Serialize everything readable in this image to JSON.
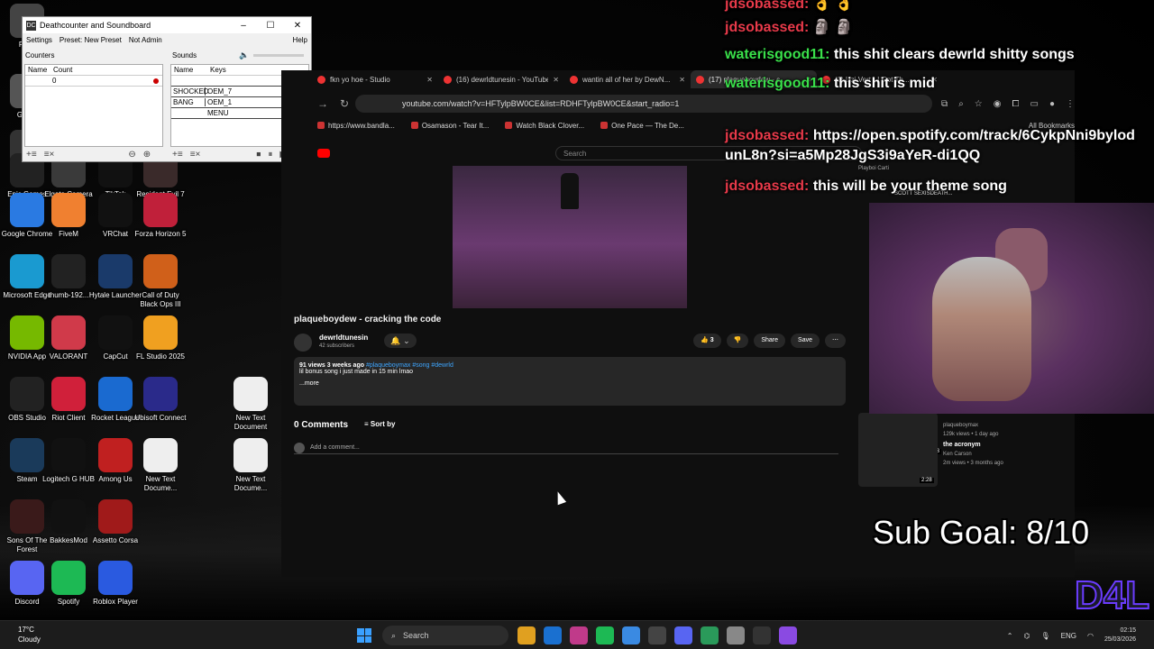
{
  "desktop": {
    "icons": [
      {
        "label": "Recy",
        "color": "#444"
      },
      {
        "label": "Grand",
        "color": "#555"
      },
      {
        "label": "EI",
        "color": "#333"
      },
      {
        "label": "Epic Games Launcher",
        "color": "#222"
      },
      {
        "label": "Elgato Camera Hub",
        "color": "#3a3a3a"
      },
      {
        "label": "TikTok",
        "color": "#111"
      },
      {
        "label": "Resident Evil 7 Biohazard",
        "color": "#3a2a2a"
      },
      {
        "label": "Google Chrome",
        "color": "#2a7ae2"
      },
      {
        "label": "FiveM",
        "color": "#f08030"
      },
      {
        "label": "VRChat",
        "color": "#111"
      },
      {
        "label": "Forza Horizon 5",
        "color": "#c0203a"
      },
      {
        "label": "Microsoft Edge",
        "color": "#1a9ad0"
      },
      {
        "label": "thumb-192...",
        "color": "#222"
      },
      {
        "label": "Hytale Launcher",
        "color": "#1a3a6a"
      },
      {
        "label": "Call of Duty Black Ops III",
        "color": "#d0601a"
      },
      {
        "label": "NVIDIA App",
        "color": "#76b900"
      },
      {
        "label": "VALORANT",
        "color": "#d03a4a"
      },
      {
        "label": "CapCut",
        "color": "#111"
      },
      {
        "label": "FL Studio 2025",
        "color": "#f0a020"
      },
      {
        "label": "OBS Studio",
        "color": "#222"
      },
      {
        "label": "Riot Client",
        "color": "#d0203a"
      },
      {
        "label": "Rocket League",
        "color": "#1a6ad0"
      },
      {
        "label": "Ubisoft Connect",
        "color": "#2a2a8a"
      },
      {
        "label": "New Text Document",
        "color": "#eee"
      },
      {
        "label": "Steam",
        "color": "#1a3a5a"
      },
      {
        "label": "Logitech G HUB",
        "color": "#111"
      },
      {
        "label": "Among Us",
        "color": "#c02020"
      },
      {
        "label": "New Text Docume...",
        "color": "#eee"
      },
      {
        "label": "New Text Docume...",
        "color": "#eee"
      },
      {
        "label": "Sons Of The Forest",
        "color": "#3a1a1a"
      },
      {
        "label": "BakkesMod",
        "color": "#111"
      },
      {
        "label": "Assetto Corsa",
        "color": "#a01a1a"
      },
      {
        "label": "Discord",
        "color": "#5865f2"
      },
      {
        "label": "Spotify",
        "color": "#1db954"
      },
      {
        "label": "Roblox Player",
        "color": "#2a5ae0"
      }
    ]
  },
  "deathcounter": {
    "title": "Deathcounter and Soundboard",
    "menu": {
      "settings": "Settings",
      "preset": "Preset: New Preset",
      "admin": "Not Admin",
      "help": "Help"
    },
    "counters_label": "Counters",
    "counters_cols": [
      "Name",
      "Count"
    ],
    "counter_value": "0",
    "sounds_label": "Sounds",
    "sounds_cols": [
      "Name",
      "Keys"
    ],
    "sounds": [
      {
        "name": "",
        "key": ""
      },
      {
        "name": "SHOCKED",
        "key": "OEM_7"
      },
      {
        "name": "BANG",
        "key": "OEM_1"
      },
      {
        "name": "",
        "key": "MENU"
      }
    ]
  },
  "browser": {
    "tabs": [
      {
        "title": "fkn yo hoe - Studio",
        "active": false
      },
      {
        "title": "(16) dewrldtunesin - YouTube",
        "active": false
      },
      {
        "title": "wantin all of her by DewN...",
        "active": false
      },
      {
        "title": "(17) plaqueboydew - c...",
        "active": true
      },
      {
        "title": "(1) Uzi Vert - I Got Th...",
        "active": false
      }
    ],
    "url": "youtube.com/watch?v=HFTylpBW0CE&list=RDHFTylpBW0CE&start_radio=1",
    "bookmarks": [
      "https://www.bandla...",
      "Osamason - Tear It...",
      "Watch Black Clover...",
      "One Pace — The De..."
    ],
    "all_bookmarks": "All Bookmarks",
    "search_placeholder": "Search"
  },
  "video": {
    "title": "plaqueboydew - cracking the code",
    "channel": "dewrldtunesin",
    "subscribers": "42 subscribers",
    "likes": "3",
    "share": "Share",
    "save": "Save",
    "views": "91 views  3 weeks ago",
    "tags": "#plaqueboymax #song #dewrld",
    "description": "lil bonus song i just made in 15 min lmao",
    "more": "...more",
    "comments": "0 Comments",
    "sort_by": "Sort by",
    "add_comment": "Add a comment..."
  },
  "sidebar": [
    {
      "title": "",
      "channel": "plaqueboymax",
      "meta": "129k views • 1 day ago",
      "duration": "1:14:43"
    },
    {
      "title": "the acronym",
      "channel": "Ken Carson",
      "meta": "2m views • 3 months ago",
      "duration": "2:28"
    }
  ],
  "sidebar_top": {
    "channel": "Playboi Carti",
    "title": "SCOTT SEXISDEATH..."
  },
  "chat": [
    {
      "user": "jdsobassed:",
      "user_color": "#e83a4a",
      "msg": "",
      "emoji": "👌 👌"
    },
    {
      "user": "jdsobassed:",
      "user_color": "#e83a4a",
      "msg": "",
      "emoji": "🗿 🗿"
    },
    {
      "user": "waterisgood11:",
      "user_color": "#39e04a",
      "msg": "this shit clears dewrld shitty songs",
      "emoji": ""
    },
    {
      "user": "waterisgood11:",
      "user_color": "#39e04a",
      "msg": "this shit is mid",
      "emoji": ""
    },
    {
      "user": "jdsobassed:",
      "user_color": "#e83a4a",
      "msg": "https://open.spotify.com/track/6CykpNni9bylod",
      "emoji": ""
    },
    {
      "user": "",
      "user_color": "#e83a4a",
      "msg": "unL8n?si=a5Mp28JgS3i9aYeR-di1QQ",
      "emoji": ""
    },
    {
      "user": "jdsobassed:",
      "user_color": "#e83a4a",
      "msg": "this will be your theme song",
      "emoji": ""
    }
  ],
  "overlay": {
    "sub_goal": "Sub Goal: 8/10",
    "logo": "D4L"
  },
  "taskbar": {
    "temp": "17°C",
    "weather": "Cloudy",
    "search": "Search",
    "lang": "ENG",
    "time": "02:15",
    "date": "25/03/2026"
  }
}
